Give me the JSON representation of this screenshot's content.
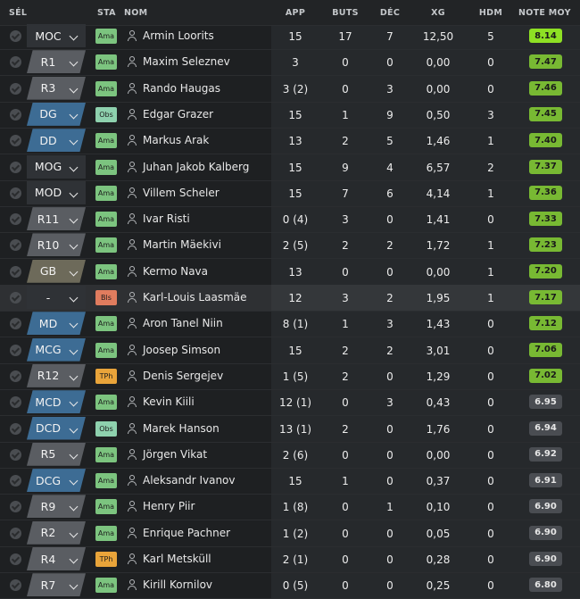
{
  "headers": {
    "sel": "SÉL",
    "sta": "STA",
    "nom": "NOM",
    "app": "APP",
    "buts": "BUTS",
    "dec": "DÉC",
    "xg": "XG",
    "hdm": "HDM",
    "note": "NOTE MOY"
  },
  "colors": {
    "pos_blue": "#3d6c94",
    "pos_gray": "#5a5d62",
    "pos_olive": "#6d6a5a",
    "status_ama": "#7cc47f",
    "status_obs": "#8ed1ae",
    "status_bls": "#e07c5e",
    "status_tph": "#e9a43a",
    "rating_bright": "#8ee024",
    "rating_green": "#78b933",
    "rating_gray": "#4a4d52"
  },
  "players": [
    {
      "pos": "MOC",
      "pos_style": "first",
      "status": "Ama",
      "status_style": "ama",
      "name": "Armin Loorits",
      "app": "15",
      "buts": "17",
      "dec": "7",
      "xg": "12,50",
      "hdm": "5",
      "note": "8.14",
      "note_style": "bright"
    },
    {
      "pos": "R1",
      "pos_style": "gray",
      "status": "Ama",
      "status_style": "ama",
      "name": "Maxim Seleznev",
      "app": "3",
      "buts": "0",
      "dec": "0",
      "xg": "0,00",
      "hdm": "0",
      "note": "7.47",
      "note_style": "green"
    },
    {
      "pos": "R3",
      "pos_style": "gray",
      "status": "Ama",
      "status_style": "ama",
      "name": "Rando Haugas",
      "app": "3 (2)",
      "buts": "0",
      "dec": "3",
      "xg": "0,00",
      "hdm": "0",
      "note": "7.46",
      "note_style": "green"
    },
    {
      "pos": "DG",
      "pos_style": "blue",
      "status": "Obs",
      "status_style": "obs",
      "name": "Edgar Grazer",
      "app": "15",
      "buts": "1",
      "dec": "9",
      "xg": "0,50",
      "hdm": "3",
      "note": "7.45",
      "note_style": "green"
    },
    {
      "pos": "DD",
      "pos_style": "blue",
      "status": "Ama",
      "status_style": "ama",
      "name": "Markus Arak",
      "app": "13",
      "buts": "2",
      "dec": "5",
      "xg": "1,46",
      "hdm": "1",
      "note": "7.40",
      "note_style": "green"
    },
    {
      "pos": "MOG",
      "pos_style": "first",
      "status": "Ama",
      "status_style": "ama",
      "name": "Juhan Jakob Kalberg",
      "app": "15",
      "buts": "9",
      "dec": "4",
      "xg": "6,57",
      "hdm": "2",
      "note": "7.37",
      "note_style": "green"
    },
    {
      "pos": "MOD",
      "pos_style": "first",
      "status": "Ama",
      "status_style": "ama",
      "name": "Villem Scheler",
      "app": "15",
      "buts": "7",
      "dec": "6",
      "xg": "4,14",
      "hdm": "1",
      "note": "7.36",
      "note_style": "green"
    },
    {
      "pos": "R11",
      "pos_style": "gray",
      "status": "Ama",
      "status_style": "ama",
      "name": "Ivar Risti",
      "app": "0 (4)",
      "buts": "3",
      "dec": "0",
      "xg": "1,41",
      "hdm": "0",
      "note": "7.33",
      "note_style": "green"
    },
    {
      "pos": "R10",
      "pos_style": "gray",
      "status": "Ama",
      "status_style": "ama",
      "name": "Martin Mäekivi",
      "app": "2 (5)",
      "buts": "2",
      "dec": "2",
      "xg": "1,72",
      "hdm": "1",
      "note": "7.23",
      "note_style": "green"
    },
    {
      "pos": "GB",
      "pos_style": "olive",
      "status": "Ama",
      "status_style": "ama",
      "name": "Kermo Nava",
      "app": "13",
      "buts": "0",
      "dec": "0",
      "xg": "0,00",
      "hdm": "1",
      "note": "7.20",
      "note_style": "green"
    },
    {
      "pos": "-",
      "pos_style": "first",
      "status": "Bls",
      "status_style": "bls",
      "name": "Karl-Louis Laasmäe",
      "app": "12",
      "buts": "3",
      "dec": "2",
      "xg": "1,95",
      "hdm": "1",
      "note": "7.17",
      "note_style": "green",
      "highlight": true
    },
    {
      "pos": "MD",
      "pos_style": "blue",
      "status": "Ama",
      "status_style": "ama",
      "name": "Aron Tanel Niin",
      "app": "8 (1)",
      "buts": "1",
      "dec": "3",
      "xg": "1,43",
      "hdm": "0",
      "note": "7.12",
      "note_style": "green"
    },
    {
      "pos": "MCG",
      "pos_style": "blue",
      "status": "Ama",
      "status_style": "ama",
      "name": "Joosep Simson",
      "app": "15",
      "buts": "2",
      "dec": "2",
      "xg": "3,01",
      "hdm": "0",
      "note": "7.06",
      "note_style": "green"
    },
    {
      "pos": "R12",
      "pos_style": "gray",
      "status": "TPh",
      "status_style": "tph",
      "name": "Denis Sergejev",
      "app": "1 (5)",
      "buts": "2",
      "dec": "0",
      "xg": "1,29",
      "hdm": "0",
      "note": "7.02",
      "note_style": "green"
    },
    {
      "pos": "MCD",
      "pos_style": "blue",
      "status": "Ama",
      "status_style": "ama",
      "name": "Kevin Kiili",
      "app": "12 (1)",
      "buts": "0",
      "dec": "3",
      "xg": "0,43",
      "hdm": "0",
      "note": "6.95",
      "note_style": "gray"
    },
    {
      "pos": "DCD",
      "pos_style": "blue",
      "status": "Obs",
      "status_style": "obs",
      "name": "Marek Hanson",
      "app": "13 (1)",
      "buts": "2",
      "dec": "0",
      "xg": "1,76",
      "hdm": "0",
      "note": "6.94",
      "note_style": "gray"
    },
    {
      "pos": "R5",
      "pos_style": "gray",
      "status": "Ama",
      "status_style": "ama",
      "name": "Jörgen Vikat",
      "app": "2 (6)",
      "buts": "0",
      "dec": "0",
      "xg": "0,00",
      "hdm": "0",
      "note": "6.92",
      "note_style": "gray"
    },
    {
      "pos": "DCG",
      "pos_style": "blue",
      "status": "Ama",
      "status_style": "ama",
      "name": "Aleksandr Ivanov",
      "app": "15",
      "buts": "1",
      "dec": "0",
      "xg": "0,37",
      "hdm": "0",
      "note": "6.91",
      "note_style": "gray"
    },
    {
      "pos": "R9",
      "pos_style": "gray",
      "status": "Ama",
      "status_style": "ama",
      "name": "Henry Piir",
      "app": "1 (8)",
      "buts": "0",
      "dec": "1",
      "xg": "0,10",
      "hdm": "0",
      "note": "6.90",
      "note_style": "gray"
    },
    {
      "pos": "R2",
      "pos_style": "gray",
      "status": "Ama",
      "status_style": "ama",
      "name": "Enrique Pachner",
      "app": "1 (2)",
      "buts": "0",
      "dec": "0",
      "xg": "0,05",
      "hdm": "0",
      "note": "6.90",
      "note_style": "gray"
    },
    {
      "pos": "R4",
      "pos_style": "gray",
      "status": "TPh",
      "status_style": "tph",
      "name": "Karl Metsküll",
      "app": "2 (1)",
      "buts": "0",
      "dec": "0",
      "xg": "0,28",
      "hdm": "0",
      "note": "6.90",
      "note_style": "gray"
    },
    {
      "pos": "R7",
      "pos_style": "gray",
      "status": "Ama",
      "status_style": "ama",
      "name": "Kirill Kornilov",
      "app": "0 (5)",
      "buts": "0",
      "dec": "0",
      "xg": "0,25",
      "hdm": "0",
      "note": "6.80",
      "note_style": "gray"
    }
  ]
}
